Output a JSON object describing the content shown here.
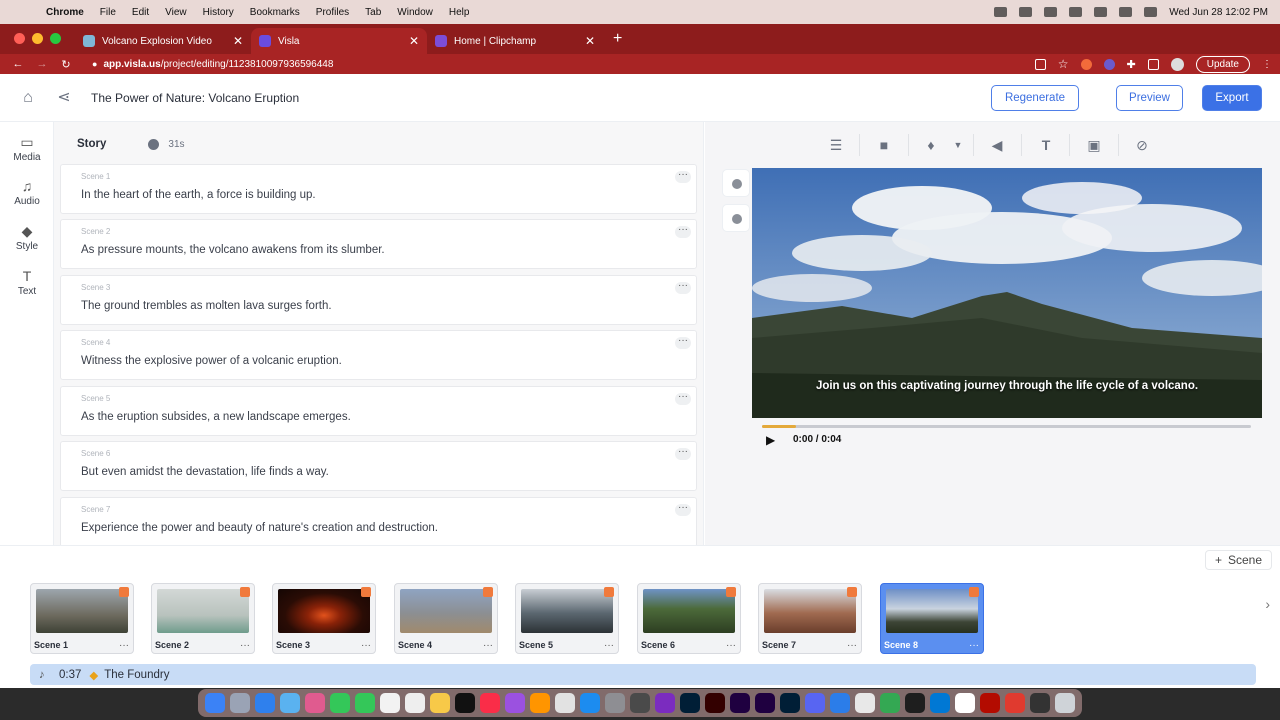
{
  "menubar": {
    "items": [
      "Chrome",
      "File",
      "Edit",
      "View",
      "History",
      "Bookmarks",
      "Profiles",
      "Tab",
      "Window",
      "Help"
    ],
    "clock": "Wed Jun 28  12:02 PM"
  },
  "browser": {
    "tabs": [
      {
        "label": "Volcano Explosion Video",
        "color": "#7fb7d6"
      },
      {
        "label": "Visla",
        "color": "#6a4ce0"
      },
      {
        "label": "Home | Clipchamp",
        "color": "#7c4dd8"
      }
    ],
    "url_host": "app.visla.us",
    "url_path": "/project/editing/1123810097936596448",
    "update_label": "Update"
  },
  "app": {
    "project_title": "The Power of Nature: Volcano Eruption",
    "buttons": {
      "regenerate": "Regenerate",
      "preview": "Preview",
      "export": "Export"
    },
    "nav": [
      "Media",
      "Audio",
      "Style",
      "Text"
    ],
    "story": {
      "title": "Story",
      "duration": "31s",
      "scenes": [
        {
          "label": "Scene 1",
          "text": "In the heart of the earth, a force is building up."
        },
        {
          "label": "Scene 2",
          "text": "As pressure mounts, the volcano awakens from its slumber."
        },
        {
          "label": "Scene 3",
          "text": "The ground trembles as molten lava surges forth."
        },
        {
          "label": "Scene 4",
          "text": "Witness the explosive power of a volcanic eruption."
        },
        {
          "label": "Scene 5",
          "text": "As the eruption subsides, a new landscape emerges."
        },
        {
          "label": "Scene 6",
          "text": "But even amidst the devastation, life finds a way."
        },
        {
          "label": "Scene 7",
          "text": "Experience the power and beauty of nature's creation and destruction."
        }
      ]
    },
    "player": {
      "caption": "Join us on this captivating journey through the life cycle of a volcano.",
      "timecode": "0:00 / 0:04",
      "progress": 0.07
    },
    "add_scene_label": "Scene",
    "timeline": {
      "thumbs": [
        {
          "label": "Scene 1",
          "color": "#6d6a5e"
        },
        {
          "label": "Scene 2",
          "color": "#b8c2bd"
        },
        {
          "label": "Scene 3",
          "color": "#3a1208"
        },
        {
          "label": "Scene 4",
          "color": "#8c8f93"
        },
        {
          "label": "Scene 5",
          "color": "#5b6770"
        },
        {
          "label": "Scene 6",
          "color": "#4c6a3a"
        },
        {
          "label": "Scene 7",
          "color": "#a06a50"
        },
        {
          "label": "Scene 8",
          "color": "#5a7bb0"
        }
      ],
      "active_index": 7,
      "audio": {
        "time": "0:37",
        "name": "The Foundry"
      }
    }
  }
}
